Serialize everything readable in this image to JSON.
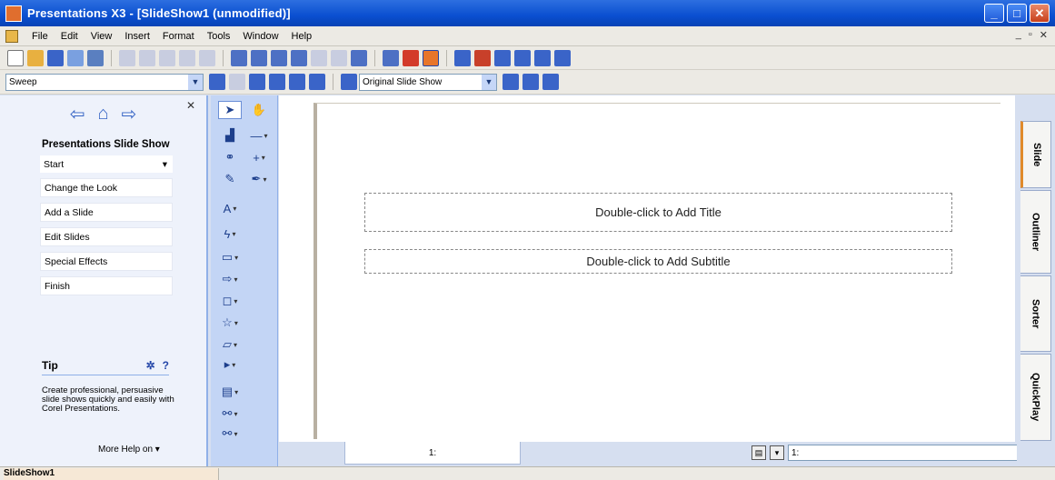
{
  "window": {
    "title": "Presentations X3 - [SlideShow1 (unmodified)]"
  },
  "window_controls": [
    "minimize",
    "maximize",
    "close"
  ],
  "menu": {
    "items": [
      "File",
      "Edit",
      "View",
      "Insert",
      "Format",
      "Tools",
      "Window",
      "Help"
    ]
  },
  "toolbar2": {
    "transition_value": "Sweep",
    "slideshow_value": "Original Slide Show"
  },
  "taskpane": {
    "heading": "Presentations Slide Show",
    "start_label": "Start",
    "steps": [
      "Change the Look",
      "Add a Slide",
      "Edit Slides",
      "Special Effects",
      "Finish"
    ],
    "tip_label": "Tip",
    "tip_text": "Create professional, persuasive slide shows quickly and easily with Corel Presentations.",
    "more_help": "More Help on ▾"
  },
  "slide": {
    "title_placeholder": "Double-click to Add Title",
    "subtitle_placeholder": "Double-click to Add Subtitle",
    "tab_label": "1:",
    "select_value": "1:"
  },
  "side_tabs": [
    "Slide",
    "Outliner",
    "Sorter",
    "QuickPlay"
  ],
  "status": {
    "document": "SlideShow1"
  },
  "colors": {
    "titlebar": "#0a4fd0",
    "task_pane": "#eef2fb",
    "tool_strip": "#c3d5f5"
  }
}
